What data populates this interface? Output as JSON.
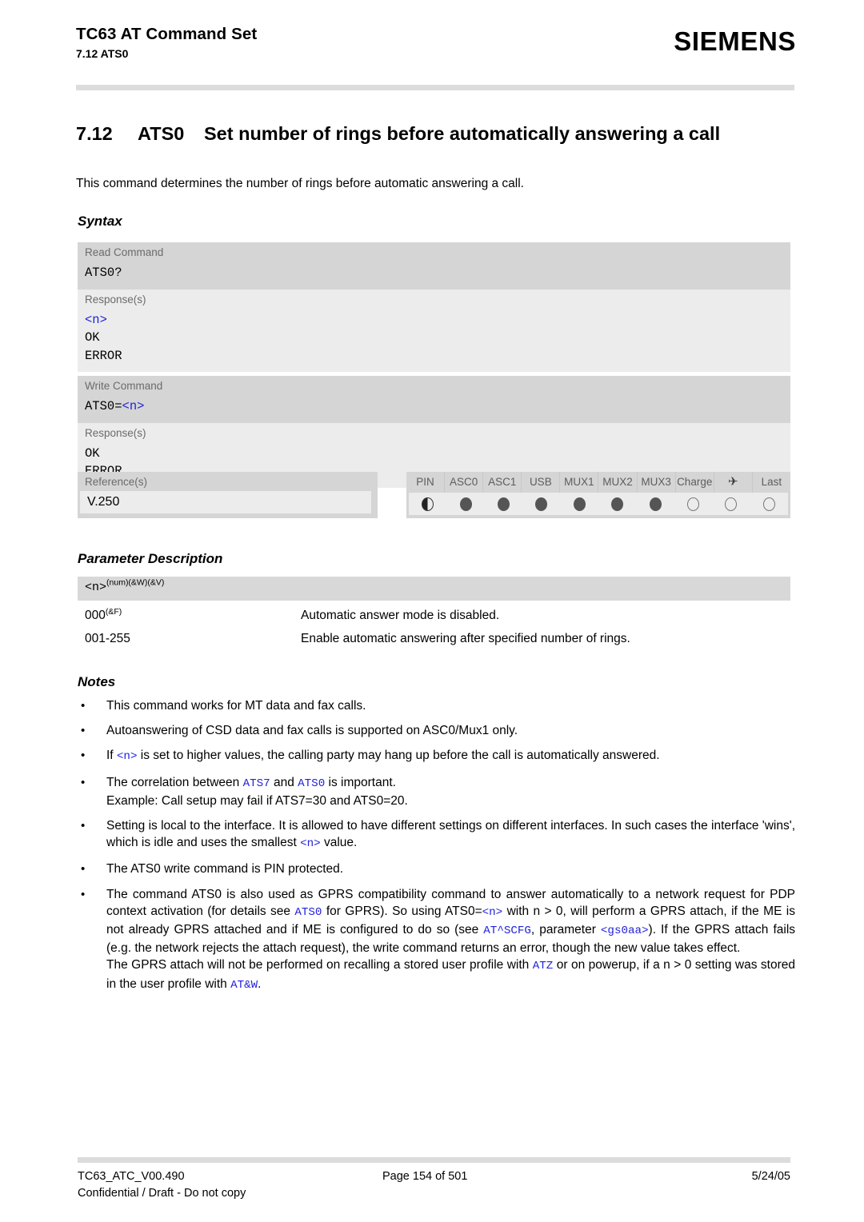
{
  "header": {
    "title": "TC63 AT Command Set",
    "subtitle": "7.12 ATS0",
    "logo": "SIEMENS"
  },
  "section": {
    "number": "7.12",
    "command": "ATS0",
    "title": "Set number of rings before automatically answering a call",
    "intro": "This command determines the number of rings before automatic answering a call."
  },
  "syntax": {
    "heading": "Syntax",
    "blocks": [
      {
        "label": "Read Command",
        "command_prefix": "ATS0?",
        "command_param": "",
        "response_label": "Response(s)",
        "response_param": "<n>",
        "response_lines": [
          "OK",
          "ERROR"
        ]
      },
      {
        "label": "Write Command",
        "command_prefix": "ATS0=",
        "command_param": "<n>",
        "response_label": "Response(s)",
        "response_param": "",
        "response_lines": [
          "OK",
          "ERROR"
        ]
      }
    ],
    "reference": {
      "label": "Reference(s)",
      "value": "V.250"
    },
    "pin_table": {
      "columns": [
        "PIN",
        "ASC0",
        "ASC1",
        "USB",
        "MUX1",
        "MUX2",
        "MUX3",
        "Charge",
        "airplane-icon",
        "Last"
      ],
      "states": [
        "half",
        "full",
        "full",
        "full",
        "full",
        "full",
        "full",
        "empty",
        "empty",
        "empty"
      ]
    }
  },
  "parameter": {
    "heading": "Parameter Description",
    "name": "<n>",
    "name_sup": "(num)(&W)(&V)",
    "rows": [
      {
        "key": "000",
        "key_sup": "(&F)",
        "desc": "Automatic answer mode is disabled."
      },
      {
        "key": "001-255",
        "key_sup": "",
        "desc": "Enable automatic answering after specified number of rings."
      }
    ]
  },
  "notes": {
    "heading": "Notes",
    "bullet": "•",
    "items": [
      {
        "parts": [
          {
            "t": "This command works for MT data and fax calls.",
            "k": "plain"
          }
        ]
      },
      {
        "parts": [
          {
            "t": "Autoanswering of CSD data and fax calls is supported on ASC0/Mux1 only.",
            "k": "plain"
          }
        ]
      },
      {
        "parts": [
          {
            "t": "If ",
            "k": "plain"
          },
          {
            "t": "<n>",
            "k": "link"
          },
          {
            "t": " is set to higher values, the calling party may hang up before the call is automatically answered.",
            "k": "plain"
          }
        ]
      },
      {
        "parts": [
          {
            "t": "The correlation between ",
            "k": "plain"
          },
          {
            "t": "ATS7",
            "k": "link"
          },
          {
            "t": " and ",
            "k": "plain"
          },
          {
            "t": "ATS0",
            "k": "link"
          },
          {
            "t": " is important.",
            "k": "plain"
          },
          {
            "t": "\n",
            "k": "br"
          },
          {
            "t": "Example: Call setup may fail if ATS7=30 and ATS0=20.",
            "k": "plain"
          }
        ]
      },
      {
        "parts": [
          {
            "t": "Setting is local to the interface. It is allowed to have different settings on different interfaces. In such cases the interface 'wins', which is idle and uses the smallest ",
            "k": "plain"
          },
          {
            "t": "<n>",
            "k": "link"
          },
          {
            "t": " value.",
            "k": "plain"
          }
        ]
      },
      {
        "parts": [
          {
            "t": "The ATS0 write command is PIN protected.",
            "k": "plain"
          }
        ]
      },
      {
        "parts": [
          {
            "t": "The command ATS0 is also used as GPRS compatibility command to answer automatically to a network request for PDP context activation (for details see ",
            "k": "plain"
          },
          {
            "t": "ATS0",
            "k": "link"
          },
          {
            "t": " for GPRS). So using ATS0=",
            "k": "plain"
          },
          {
            "t": "<n>",
            "k": "link"
          },
          {
            "t": " with n > 0, will perform a GPRS attach, if the ME is not already GPRS attached and if ME is configured to do so (see ",
            "k": "plain"
          },
          {
            "t": "AT^SCFG",
            "k": "link"
          },
          {
            "t": ", parameter ",
            "k": "plain"
          },
          {
            "t": "<gs0aa>",
            "k": "link"
          },
          {
            "t": "). If the GPRS attach fails (e.g. the network rejects the attach request), the write command returns an error, though the new value takes effect.",
            "k": "plain"
          },
          {
            "t": "\n",
            "k": "br"
          },
          {
            "t": "The GPRS attach will not be performed on recalling a stored user profile with ",
            "k": "plain"
          },
          {
            "t": "ATZ",
            "k": "link"
          },
          {
            "t": " or on powerup, if a n > 0 setting was stored in the user profile with ",
            "k": "plain"
          },
          {
            "t": "AT&W",
            "k": "link"
          },
          {
            "t": ".",
            "k": "plain"
          }
        ]
      }
    ]
  },
  "footer": {
    "doc_id": "TC63_ATC_V00.490",
    "page": "Page 154 of 501",
    "date": "5/24/05",
    "confidential": "Confidential / Draft - Do not copy"
  },
  "colors": {
    "link": "#2222dd",
    "header_gray": "#d5d5d5",
    "body_gray": "#ececec",
    "rule_gray": "#dcdcdc"
  }
}
